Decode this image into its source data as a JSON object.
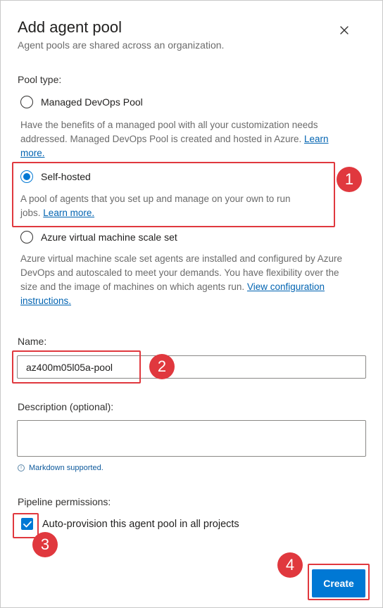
{
  "dialog": {
    "title": "Add agent pool",
    "subtitle": "Agent pools are shared across an organization.",
    "close_icon": "close-icon"
  },
  "pool_type": {
    "label": "Pool type:",
    "options": [
      {
        "label": "Managed DevOps Pool",
        "selected": false,
        "desc_line1": "Have the benefits of a managed pool with all your customization needs",
        "desc_line2": "addressed. Managed DevOps Pool is created and hosted in Azure.",
        "link1": "Learn",
        "link2": "more."
      },
      {
        "label": "Self-hosted",
        "selected": true,
        "desc_line1": "A pool of agents that you set up and manage on your own to run",
        "desc_line2": "jobs.",
        "link": "Learn more."
      },
      {
        "label": "Azure virtual machine scale set",
        "selected": false,
        "desc_line1": "Azure virtual machine scale set agents are installed and configured by Azure",
        "desc_line2": "DevOps and autoscaled to meet your demands. You have flexibility over the",
        "desc_line3": "size and the image of machines on which agents run.",
        "link1": "View configuration",
        "link2": "instructions."
      }
    ]
  },
  "name": {
    "label": "Name:",
    "value": "az400m05l05a-pool"
  },
  "description": {
    "label": "Description (optional):",
    "value": "",
    "hint": "Markdown supported."
  },
  "permissions": {
    "label": "Pipeline permissions:",
    "checkbox_label": "Auto-provision this agent pool in all projects",
    "checked": true
  },
  "actions": {
    "create_label": "Create"
  },
  "annotations": {
    "badges": [
      "1",
      "2",
      "3",
      "4"
    ],
    "color": "#e0383e"
  },
  "colors": {
    "accent": "#0078d4",
    "link": "#0063b1",
    "muted_text": "#6b6b6b"
  }
}
